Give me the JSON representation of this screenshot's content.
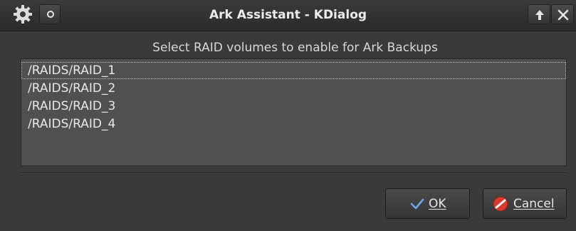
{
  "window": {
    "title": "Ark Assistant - KDialog"
  },
  "dialog": {
    "prompt": "Select RAID volumes to enable for Ark Backups",
    "items": [
      {
        "label": "/RAIDS/RAID_1"
      },
      {
        "label": "/RAIDS/RAID_2"
      },
      {
        "label": "/RAIDS/RAID_3"
      },
      {
        "label": "/RAIDS/RAID_4"
      }
    ]
  },
  "buttons": {
    "ok": "OK",
    "cancel": "Cancel"
  },
  "icons": {
    "menu": "gear-icon",
    "pin": "pin-icon",
    "keep_above": "arrow-up-icon",
    "close": "close-icon",
    "ok": "checkmark-icon",
    "cancel": "cancel-icon"
  },
  "colors": {
    "background": "#3a3a3a",
    "list_background": "#505050",
    "ok_check": "#6aa6e8",
    "cancel_red": "#d93a2b"
  }
}
